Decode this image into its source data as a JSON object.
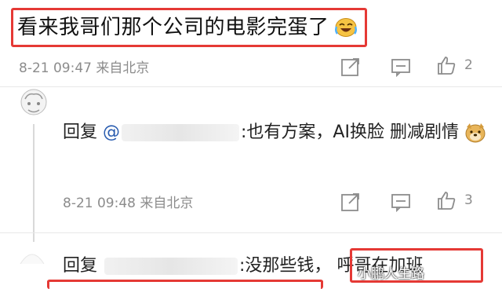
{
  "comment": {
    "text": "看来我哥们那个公司的电影完蛋了",
    "emoji": "laughing-crying-emoji",
    "meta": "8-21 09:47  来自北京",
    "likes": "2"
  },
  "reply1": {
    "prefix": "回复",
    "mention": "@",
    "text": ":也有方案，AI换脸 删减剧情",
    "emoji": "doge-emoji",
    "meta": "8-21 09:48  来自北京",
    "likes": "3"
  },
  "reply2": {
    "prefix": "回复",
    "text": ":没那些钱，",
    "tail": "呼哥在加班"
  },
  "watermark": "小鹏人生路",
  "colors": {
    "highlight": "#e53935",
    "meta": "#8c8c8c",
    "mention": "#2a5db0"
  }
}
